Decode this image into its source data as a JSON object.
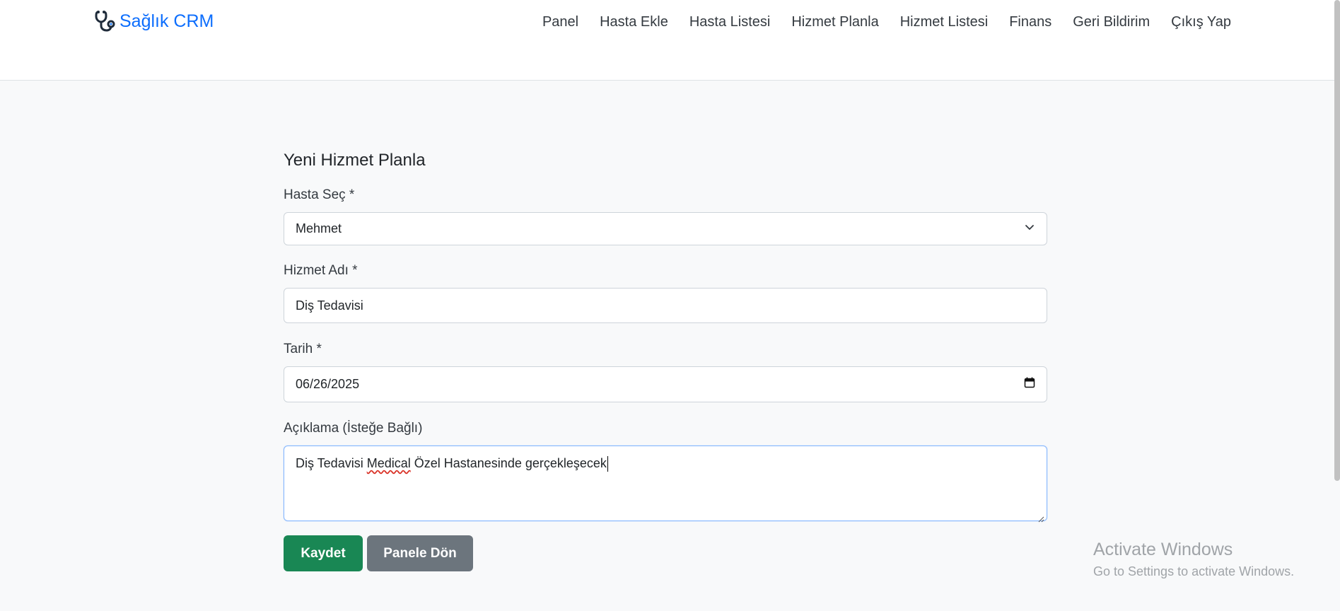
{
  "navbar": {
    "brand": "Sağlık CRM",
    "links": [
      "Panel",
      "Hasta Ekle",
      "Hasta Listesi",
      "Hizmet Planla",
      "Hizmet Listesi",
      "Finans",
      "Geri Bildirim",
      "Çıkış Yap"
    ],
    "brand_icon": "stethoscope-icon",
    "brand_color": "#0d6efd"
  },
  "form": {
    "title": "Yeni Hizmet Planla",
    "patient_label": "Hasta Seç *",
    "patient_value": "Mehmet",
    "service_label": "Hizmet Adı *",
    "service_value": "Diş Tedavisi",
    "date_label": "Tarih *",
    "date_value": "06/26/2025",
    "description_label": "Açıklama (İsteğe Bağlı)",
    "description_before": "Diş Tedavisi ",
    "description_misspelled": "Medical",
    "description_after": " Özel Hastanesinde gerçekleşecek",
    "save_label": "Kaydet",
    "back_label": "Panele Dön",
    "save_color": "#198754",
    "back_color": "#6c757d"
  },
  "watermark": {
    "title": "Activate Windows",
    "subtitle": "Go to Settings to activate Windows."
  }
}
